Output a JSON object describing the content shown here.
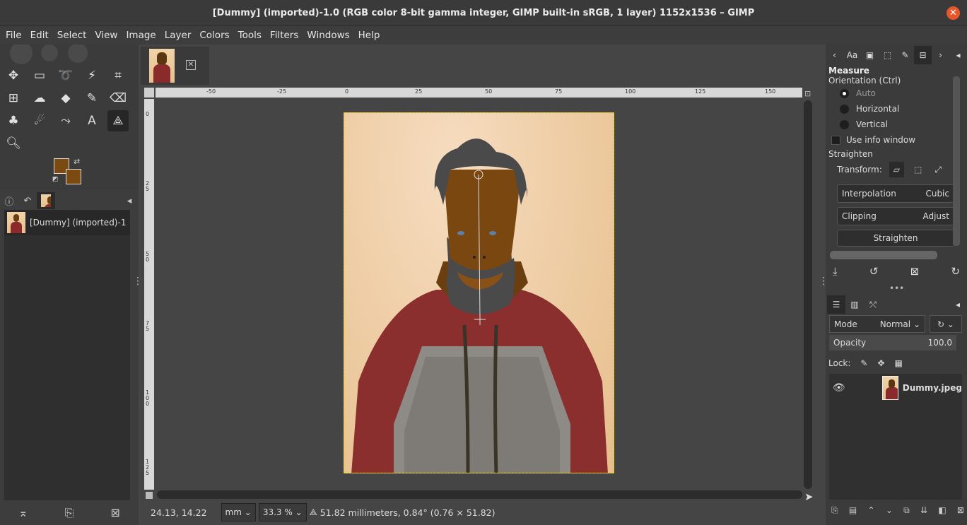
{
  "window": {
    "title": "[Dummy] (imported)-1.0 (RGB color 8-bit gamma integer, GIMP built-in sRGB, 1 layer) 1152x1536 – GIMP"
  },
  "menu": [
    "File",
    "Edit",
    "Select",
    "View",
    "Image",
    "Layer",
    "Colors",
    "Tools",
    "Filters",
    "Windows",
    "Help"
  ],
  "colors": {
    "foreground": "#7a4a10",
    "background": "#7a4a10"
  },
  "images_panel": {
    "item": "[Dummy] (imported)-1"
  },
  "ruler": {
    "h_ticks": [
      "-50",
      "-25",
      "0",
      "25",
      "50",
      "75",
      "100",
      "125",
      "150"
    ],
    "v_ticks": [
      "0",
      "2\n5",
      "5\n0",
      "7\n5",
      "1\n0\n0",
      "1\n2\n5"
    ]
  },
  "status": {
    "coords": "24.13, 14.22",
    "unit": "mm",
    "zoom": "33.3 %",
    "message": "51.82 millimeters, 0.84° (0.76 × 51.82)"
  },
  "tool_options": {
    "title": "Measure",
    "orientation_label": "Orientation  (Ctrl)",
    "orientation_options": [
      "Auto",
      "Horizontal",
      "Vertical"
    ],
    "use_info_window": "Use info window",
    "straighten_label": "Straighten",
    "transform_label": "Transform:",
    "interpolation_label": "Interpolation",
    "interpolation_value": "Cubic",
    "clipping_label": "Clipping",
    "clipping_value": "Adjust",
    "straighten_button": "Straighten"
  },
  "layers": {
    "mode_label": "Mode",
    "mode_value": "Normal",
    "opacity_label": "Opacity",
    "opacity_value": "100.0",
    "lock_label": "Lock:",
    "layer_name": "Dummy.jpeg"
  }
}
